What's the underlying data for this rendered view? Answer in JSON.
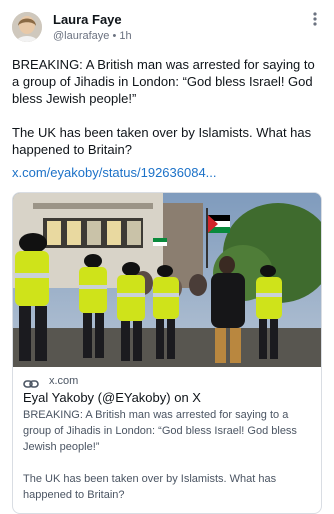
{
  "author": {
    "name": "Laura Faye",
    "handle": "@laurafaye",
    "separator": "•",
    "time": "1h"
  },
  "post": {
    "paragraph1": "BREAKING: A British man was arrested for saying to a group of Jihadis in London: “God bless Israel! God bless Jewish people!”",
    "paragraph2": "The UK has been taken over by Islamists. What has happened to Britain?",
    "link": "x.com/eyakoby/status/192636084..."
  },
  "card": {
    "domain": "x.com",
    "title": "Eyal Yakoby (@EYakoby) on X",
    "desc1": "BREAKING: A British man was arrested for saying to a group of Jihadis in London: “God bless Israel! God bless Jewish people!”",
    "desc2": "The UK has been taken over by Islamists. What has happened to Britain?"
  },
  "icons": {
    "more": "more-horizontal-icon",
    "link": "link-chain-icon"
  },
  "colors": {
    "link": "#1d72c8",
    "muted": "#6b7280",
    "police_vest": "#cfe31a"
  }
}
